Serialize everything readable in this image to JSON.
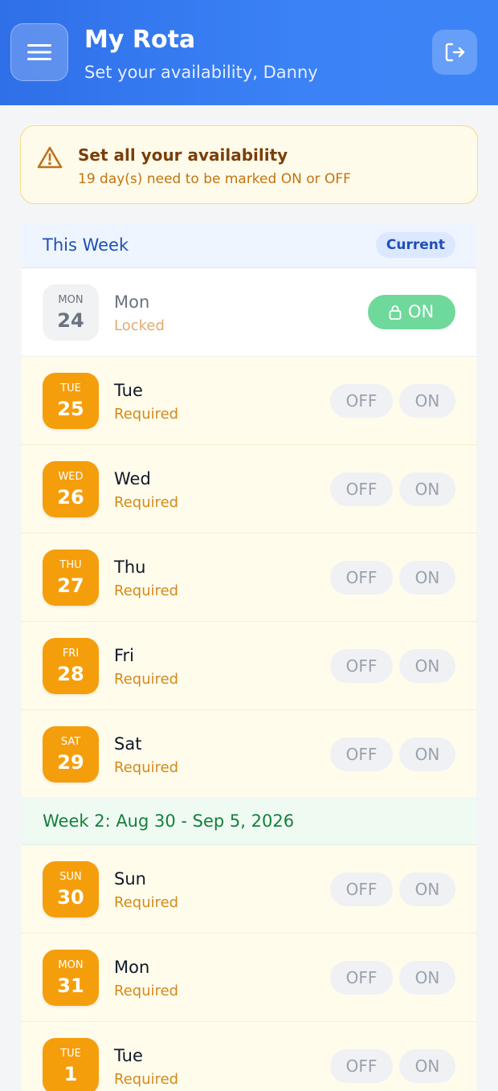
{
  "header": {
    "title": "My Rota",
    "subtitle": "Set your availability, Danny"
  },
  "alert": {
    "title": "Set all your availability",
    "text": "19 day(s) need to be marked ON or OFF"
  },
  "this_week": {
    "title": "This Week",
    "badge": "Current",
    "locked_day": {
      "dow": "MON",
      "num": "24",
      "name": "Mon",
      "status": "Locked",
      "toggle": "ON"
    },
    "days": [
      {
        "dow": "TUE",
        "num": "25",
        "name": "Tue",
        "status": "Required"
      },
      {
        "dow": "WED",
        "num": "26",
        "name": "Wed",
        "status": "Required"
      },
      {
        "dow": "THU",
        "num": "27",
        "name": "Thu",
        "status": "Required"
      },
      {
        "dow": "FRI",
        "num": "28",
        "name": "Fri",
        "status": "Required"
      },
      {
        "dow": "SAT",
        "num": "29",
        "name": "Sat",
        "status": "Required"
      }
    ]
  },
  "week2": {
    "title": "Week 2: Aug 30 - Sep 5, 2026",
    "days": [
      {
        "dow": "SUN",
        "num": "30",
        "name": "Sun",
        "status": "Required"
      },
      {
        "dow": "MON",
        "num": "31",
        "name": "Mon",
        "status": "Required"
      },
      {
        "dow": "TUE",
        "num": "1",
        "name": "Tue",
        "status": "Required"
      }
    ]
  },
  "toggle": {
    "off": "OFF",
    "on": "ON"
  },
  "colors": {
    "header_blue": "#3b82f6",
    "amber": "#f59e0b",
    "on_green": "#6ed99a",
    "week2_green": "#15803d"
  },
  "icons": {
    "menu": "hamburger-icon",
    "logout": "logout-icon",
    "alert": "warning-triangle-icon",
    "lock": "lock-icon"
  }
}
